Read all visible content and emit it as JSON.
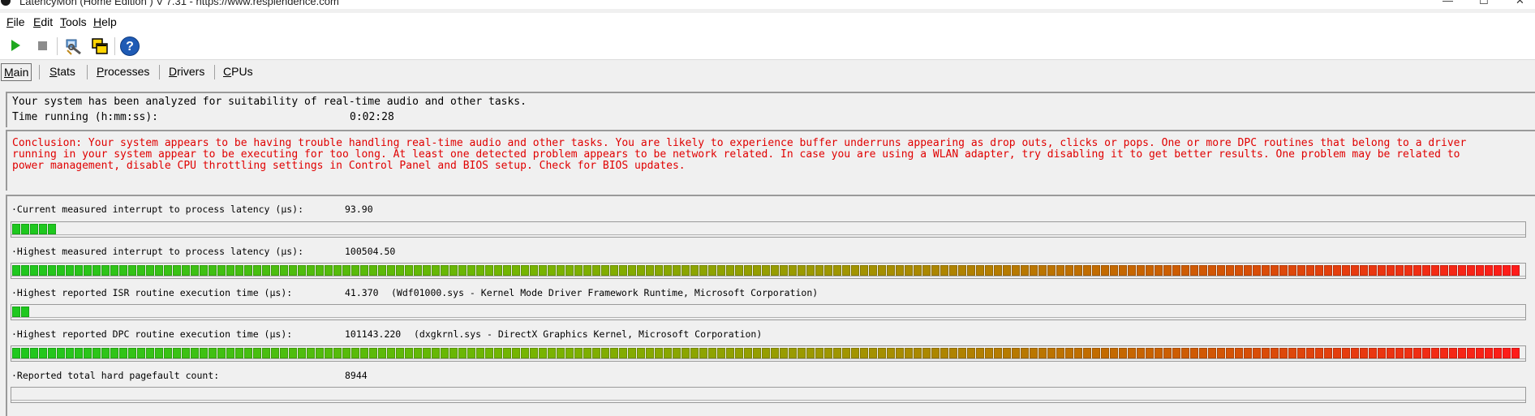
{
  "window": {
    "title": "LatencyMon  (Home Edition )  V 7.31 - https://www.resplendence.com",
    "minimize_glyph": "—",
    "maximize_glyph": "☐",
    "close_glyph": "✕"
  },
  "menu": [
    "File",
    "Edit",
    "Tools",
    "Help"
  ],
  "toolbar": {
    "start": "play-icon",
    "stop": "stop-icon",
    "tools": "tools-icon",
    "windows": "windows-icon",
    "help": "help-icon",
    "help_glyph": "?"
  },
  "tabs": [
    "Main",
    "Stats",
    "Processes",
    "Drivers",
    "CPUs"
  ],
  "active_tab": "Main",
  "info": {
    "analyzed_text": "Your system has been analyzed for suitability of real-time audio and other tasks.",
    "time_label": "Time running (h:mm:ss):",
    "time_value": "0:02:28"
  },
  "conclusion": {
    "lines": [
      "Conclusion: Your system appears to be having trouble handling real-time audio and other tasks. You are likely to experience buffer underruns appearing as drop outs, clicks or pops. One or more DPC routines that belong to a driver",
      "running in your system appear to be executing for too long. At least one detected problem appears to be network related. In case you are using a WLAN adapter, try disabling it to get better results. One problem may be related to",
      "power management, disable CPU throttling settings in Control Panel and BIOS setup. Check for BIOS updates."
    ],
    "color": "#e00000"
  },
  "metrics": [
    {
      "label": "·Current measured interrupt to process latency (µs):",
      "value": "93.90",
      "detail": "",
      "level": 0.027
    },
    {
      "label": "·Highest measured interrupt to process latency (µs):",
      "value": "100504.50",
      "detail": "",
      "level": 1.0
    },
    {
      "label": "·Highest reported ISR routine execution time (µs):",
      "value": "41.370",
      "detail": "(Wdf01000.sys - Kernel Mode Driver Framework Runtime, Microsoft Corporation)",
      "level": 0.012
    },
    {
      "label": "·Highest reported DPC routine execution time (µs):",
      "value": "101143.220",
      "detail": "(dxgkrnl.sys - DirectX Graphics Kernel, Microsoft Corporation)",
      "level": 1.0
    },
    {
      "label": "·Reported total hard pagefault count:",
      "value": "8944",
      "detail": "",
      "level": 0
    }
  ],
  "colors": {
    "bar_green": "#1ec81e",
    "bar_olive": "#a0a000",
    "bar_orange": "#c86400",
    "bar_red": "#ff1a1a"
  }
}
